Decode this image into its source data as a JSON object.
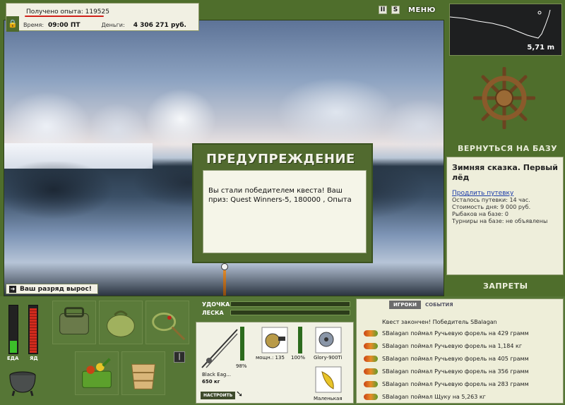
{
  "info": {
    "experience_label": "Получено опыта:",
    "experience_value": "119525",
    "time_label": "Время:",
    "time_value": "09:00 ПТ",
    "money_label": "Деньги:",
    "money_value": "4 306 271 руб."
  },
  "top_icons": {
    "pause": "II",
    "sound": "S",
    "menu": "МЕНЮ"
  },
  "depth": {
    "value": "5,71 m"
  },
  "right": {
    "return_label": "ВЕРНУТЬСЯ НА БАЗУ",
    "trip_title": "Зимняя сказка. Первый лёд",
    "extend_link": "Продлить путевку",
    "lines": [
      "Осталось путевки: 14 час.",
      "Стоимость дня: 9 000 руб.",
      "Рыбаков на базе: 0",
      "Турниры на базе: не объявлены"
    ],
    "bans_label": "ЗАПРЕТЫ"
  },
  "dialog": {
    "title": "ПРЕДУПРЕЖДЕНИЕ",
    "text": "Вы стали победителем квеста! Ваш приз: Quest Winners-5, 180000 , Опыта"
  },
  "rank_message": "Ваш разряд вырос!",
  "gauges": {
    "food_label": "ЕДА",
    "poison_label": "ЯД",
    "food_level": 0.25,
    "poison_level": 0.95
  },
  "rod_panel": {
    "rod_label": "УДОЧКА",
    "line_label": "ЛЕСКА",
    "rod_name": "Black Eag...",
    "rod_weight": "650 кг",
    "rod_percent": "98%",
    "reel_power": "мощн.: 135",
    "reel_percent": "100%",
    "line_name": "Glory-900Ti",
    "lure_name": "Маленькая",
    "setup_button": "НАСТРОИТЬ"
  },
  "events": {
    "tab_players": "ИГРОКИ",
    "tab_events": "СОБЫТИЯ",
    "header": "Квест закончен! Победитель SBalagan",
    "messages": [
      "SBalagan поймал Ручьевую форель на 429 грамм",
      "SBalagan поймал Ручьевую форель на 1,184 кг",
      "SBalagan поймал Ручьевую форель на 405 грамм",
      "SBalagan поймал Ручьевую форель на 356 грамм",
      "SBalagan поймал Ручьевую форель на 283 грамм",
      "SBalagan поймал Щуку на 5,263 кг"
    ]
  }
}
